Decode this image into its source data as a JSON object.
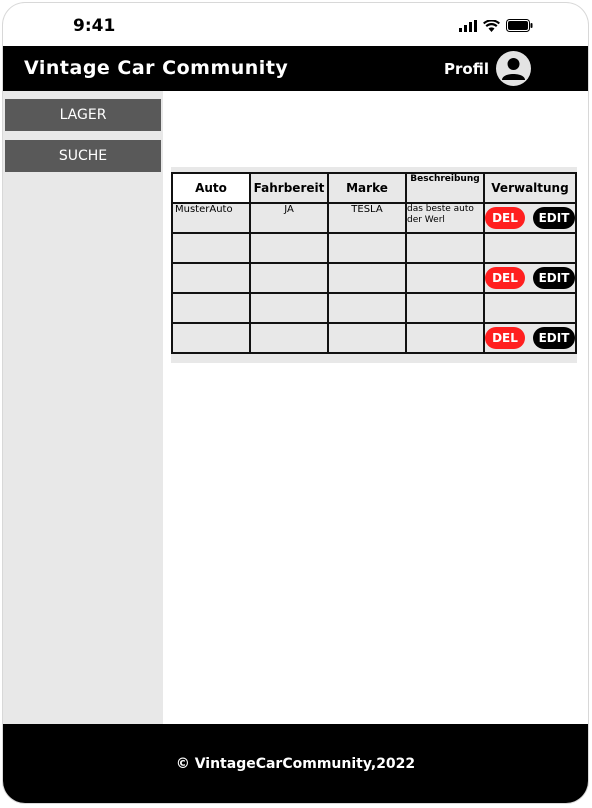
{
  "status_bar": {
    "time": "9:41"
  },
  "header": {
    "title": "Vintage Car Community",
    "profile_label": "Profil"
  },
  "sidebar": {
    "items": [
      {
        "label": "LAGER"
      },
      {
        "label": "SUCHE"
      }
    ]
  },
  "table": {
    "columns": [
      "Auto",
      "Fahrbereit",
      "Marke",
      "Beschreibung",
      "Verwaltung"
    ],
    "rows": [
      {
        "auto": "MusterAuto",
        "fahrbereit": "JA",
        "marke": "TESLA",
        "beschreibung": "das beste auto der Werl",
        "actions": true
      },
      {
        "auto": "",
        "fahrbereit": "",
        "marke": "",
        "beschreibung": "",
        "actions": false
      },
      {
        "auto": "",
        "fahrbereit": "",
        "marke": "",
        "beschreibung": "",
        "actions": true
      },
      {
        "auto": "",
        "fahrbereit": "",
        "marke": "",
        "beschreibung": "",
        "actions": false
      },
      {
        "auto": "",
        "fahrbereit": "",
        "marke": "",
        "beschreibung": "",
        "actions": true
      }
    ],
    "del_label": "DEL",
    "edit_label": "EDIT"
  },
  "footer": {
    "text": "©  VintageCarCommunity,2022"
  },
  "colors": {
    "header_bg": "#000000",
    "nav_button_bg": "#595959",
    "sidebar_bg": "#e8e8e8",
    "del_bg": "#ff1f1f",
    "edit_bg": "#000000"
  }
}
